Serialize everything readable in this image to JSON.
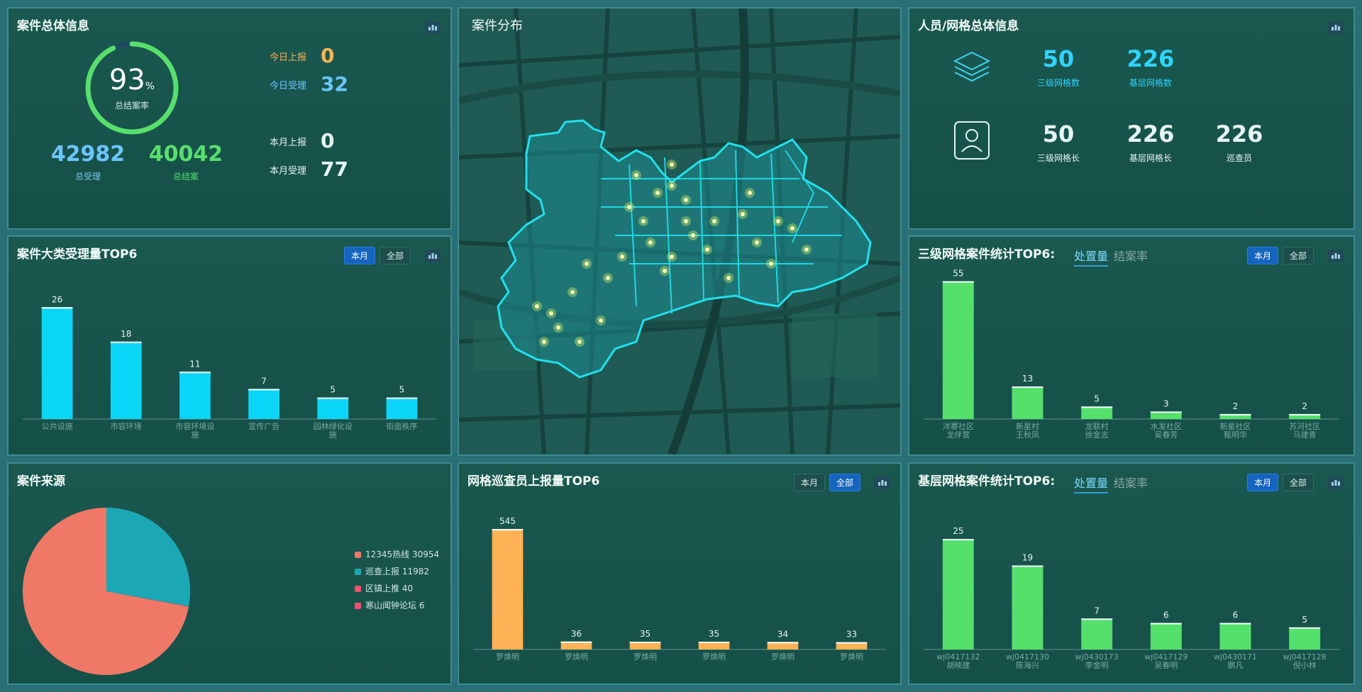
{
  "overview": {
    "title": "案件总体信息",
    "rate_value": "93",
    "rate_unit": "%",
    "rate_fraction": 0.93,
    "rate_label": "总结案率",
    "total_accept": "42982",
    "total_accept_label": "总受理",
    "total_close": "40042",
    "total_close_label": "总结案",
    "today_report_label": "今日上报",
    "today_report": "0",
    "today_accept_label": "今日受理",
    "today_accept": "32",
    "month_report_label": "本月上报",
    "month_report": "0",
    "month_accept_label": "本月受理",
    "month_accept": "77"
  },
  "map_panel": {
    "title": "案件分布"
  },
  "personnel": {
    "title": "人员/网格总体信息",
    "row1": [
      {
        "value": "50",
        "label": "三级网格数"
      },
      {
        "value": "226",
        "label": "基层网格数"
      }
    ],
    "row2": [
      {
        "value": "50",
        "label": "三级网格长"
      },
      {
        "value": "226",
        "label": "基层网格长"
      },
      {
        "value": "226",
        "label": "巡查员"
      }
    ]
  },
  "tab_labels": {
    "month": "本月",
    "all": "全部"
  },
  "sub_labels": {
    "handled": "处置量",
    "rate": "结案率"
  },
  "colors": {
    "cyan": "#0bd6f8",
    "green": "#54e06a",
    "orange": "#ffb255",
    "pie_red": "#f07866",
    "pie_teal": "#1ca7b5",
    "pie_pink": "#f0506e"
  },
  "category_top6": {
    "title": "案件大类受理量TOP6",
    "chart_data": {
      "type": "bar",
      "categories": [
        "公共设施",
        "市容环境",
        "市容环境设施",
        "宣传广告",
        "园林绿化设施",
        "街面秩序"
      ],
      "category_lines": [
        [
          "公共设施"
        ],
        [
          "市容环境"
        ],
        [
          "市容环境设",
          "施"
        ],
        [
          "宣传广告"
        ],
        [
          "园林绿化设",
          "施"
        ],
        [
          "街面秩序"
        ]
      ],
      "values": [
        26,
        18,
        11,
        7,
        5,
        5
      ],
      "ylim": [
        0,
        30
      ]
    }
  },
  "grid3_top6": {
    "title": "三级网格案件统计TOP6:",
    "chart_data": {
      "type": "bar",
      "categories": [
        "洋寨社区 龙伴营",
        "新星村 王秋凤",
        "龙联村 徐金志",
        "水发社区 吴春芳",
        "新星社区 甄明华",
        "苏河社区 马建青"
      ],
      "category_lines": [
        [
          "洋寨社区",
          "龙伴营"
        ],
        [
          "新星村",
          "王秋凤"
        ],
        [
          "龙联村",
          "徐金志"
        ],
        [
          "水发社区",
          "吴春芳"
        ],
        [
          "新星社区",
          "甄明华"
        ],
        [
          "苏河社区",
          "马建青"
        ]
      ],
      "values": [
        55,
        13,
        5,
        3,
        2,
        2
      ],
      "ylim": [
        0,
        60
      ]
    }
  },
  "source": {
    "title": "案件来源",
    "chart_data": {
      "type": "pie",
      "slices": [
        {
          "name": "12345热线",
          "value": 30954
        },
        {
          "name": "巡查上报",
          "value": 11982
        },
        {
          "name": "区镇上推",
          "value": 40
        },
        {
          "name": "寒山闻钟论坛",
          "value": 6
        }
      ]
    }
  },
  "inspector_top6": {
    "title": "网格巡查员上报量TOP6",
    "chart_data": {
      "type": "bar",
      "categories": [
        "罗焕明",
        "罗焕明",
        "罗焕明",
        "罗焕明",
        "罗焕明",
        "罗焕明"
      ],
      "category_lines": [
        [
          "罗焕明"
        ],
        [
          "罗焕明"
        ],
        [
          "罗焕明"
        ],
        [
          "罗焕明"
        ],
        [
          "罗焕明"
        ],
        [
          "罗焕明"
        ]
      ],
      "values": [
        545,
        36,
        35,
        35,
        34,
        33
      ],
      "ylim": [
        0,
        600
      ]
    }
  },
  "base_top6": {
    "title": "基层网格案件统计TOP6:",
    "chart_data": {
      "type": "bar",
      "categories": [
        "wj0417132 胡映建",
        "wj0417130 陈海兴",
        "wj0430173 李金明",
        "wj0417129 吴春明",
        "wj0430171 鹏凡",
        "wj0417128 倪小林"
      ],
      "category_lines": [
        [
          "wj0417132",
          "胡映建"
        ],
        [
          "wj0417130",
          "陈海兴"
        ],
        [
          "wj0430173",
          "李金明"
        ],
        [
          "wj0417129",
          "吴春明"
        ],
        [
          "wj0430171",
          "鹏凡"
        ],
        [
          "wj0417128",
          "倪小林"
        ]
      ],
      "values": [
        25,
        19,
        7,
        6,
        6,
        5
      ],
      "ylim": [
        0,
        30
      ]
    }
  }
}
